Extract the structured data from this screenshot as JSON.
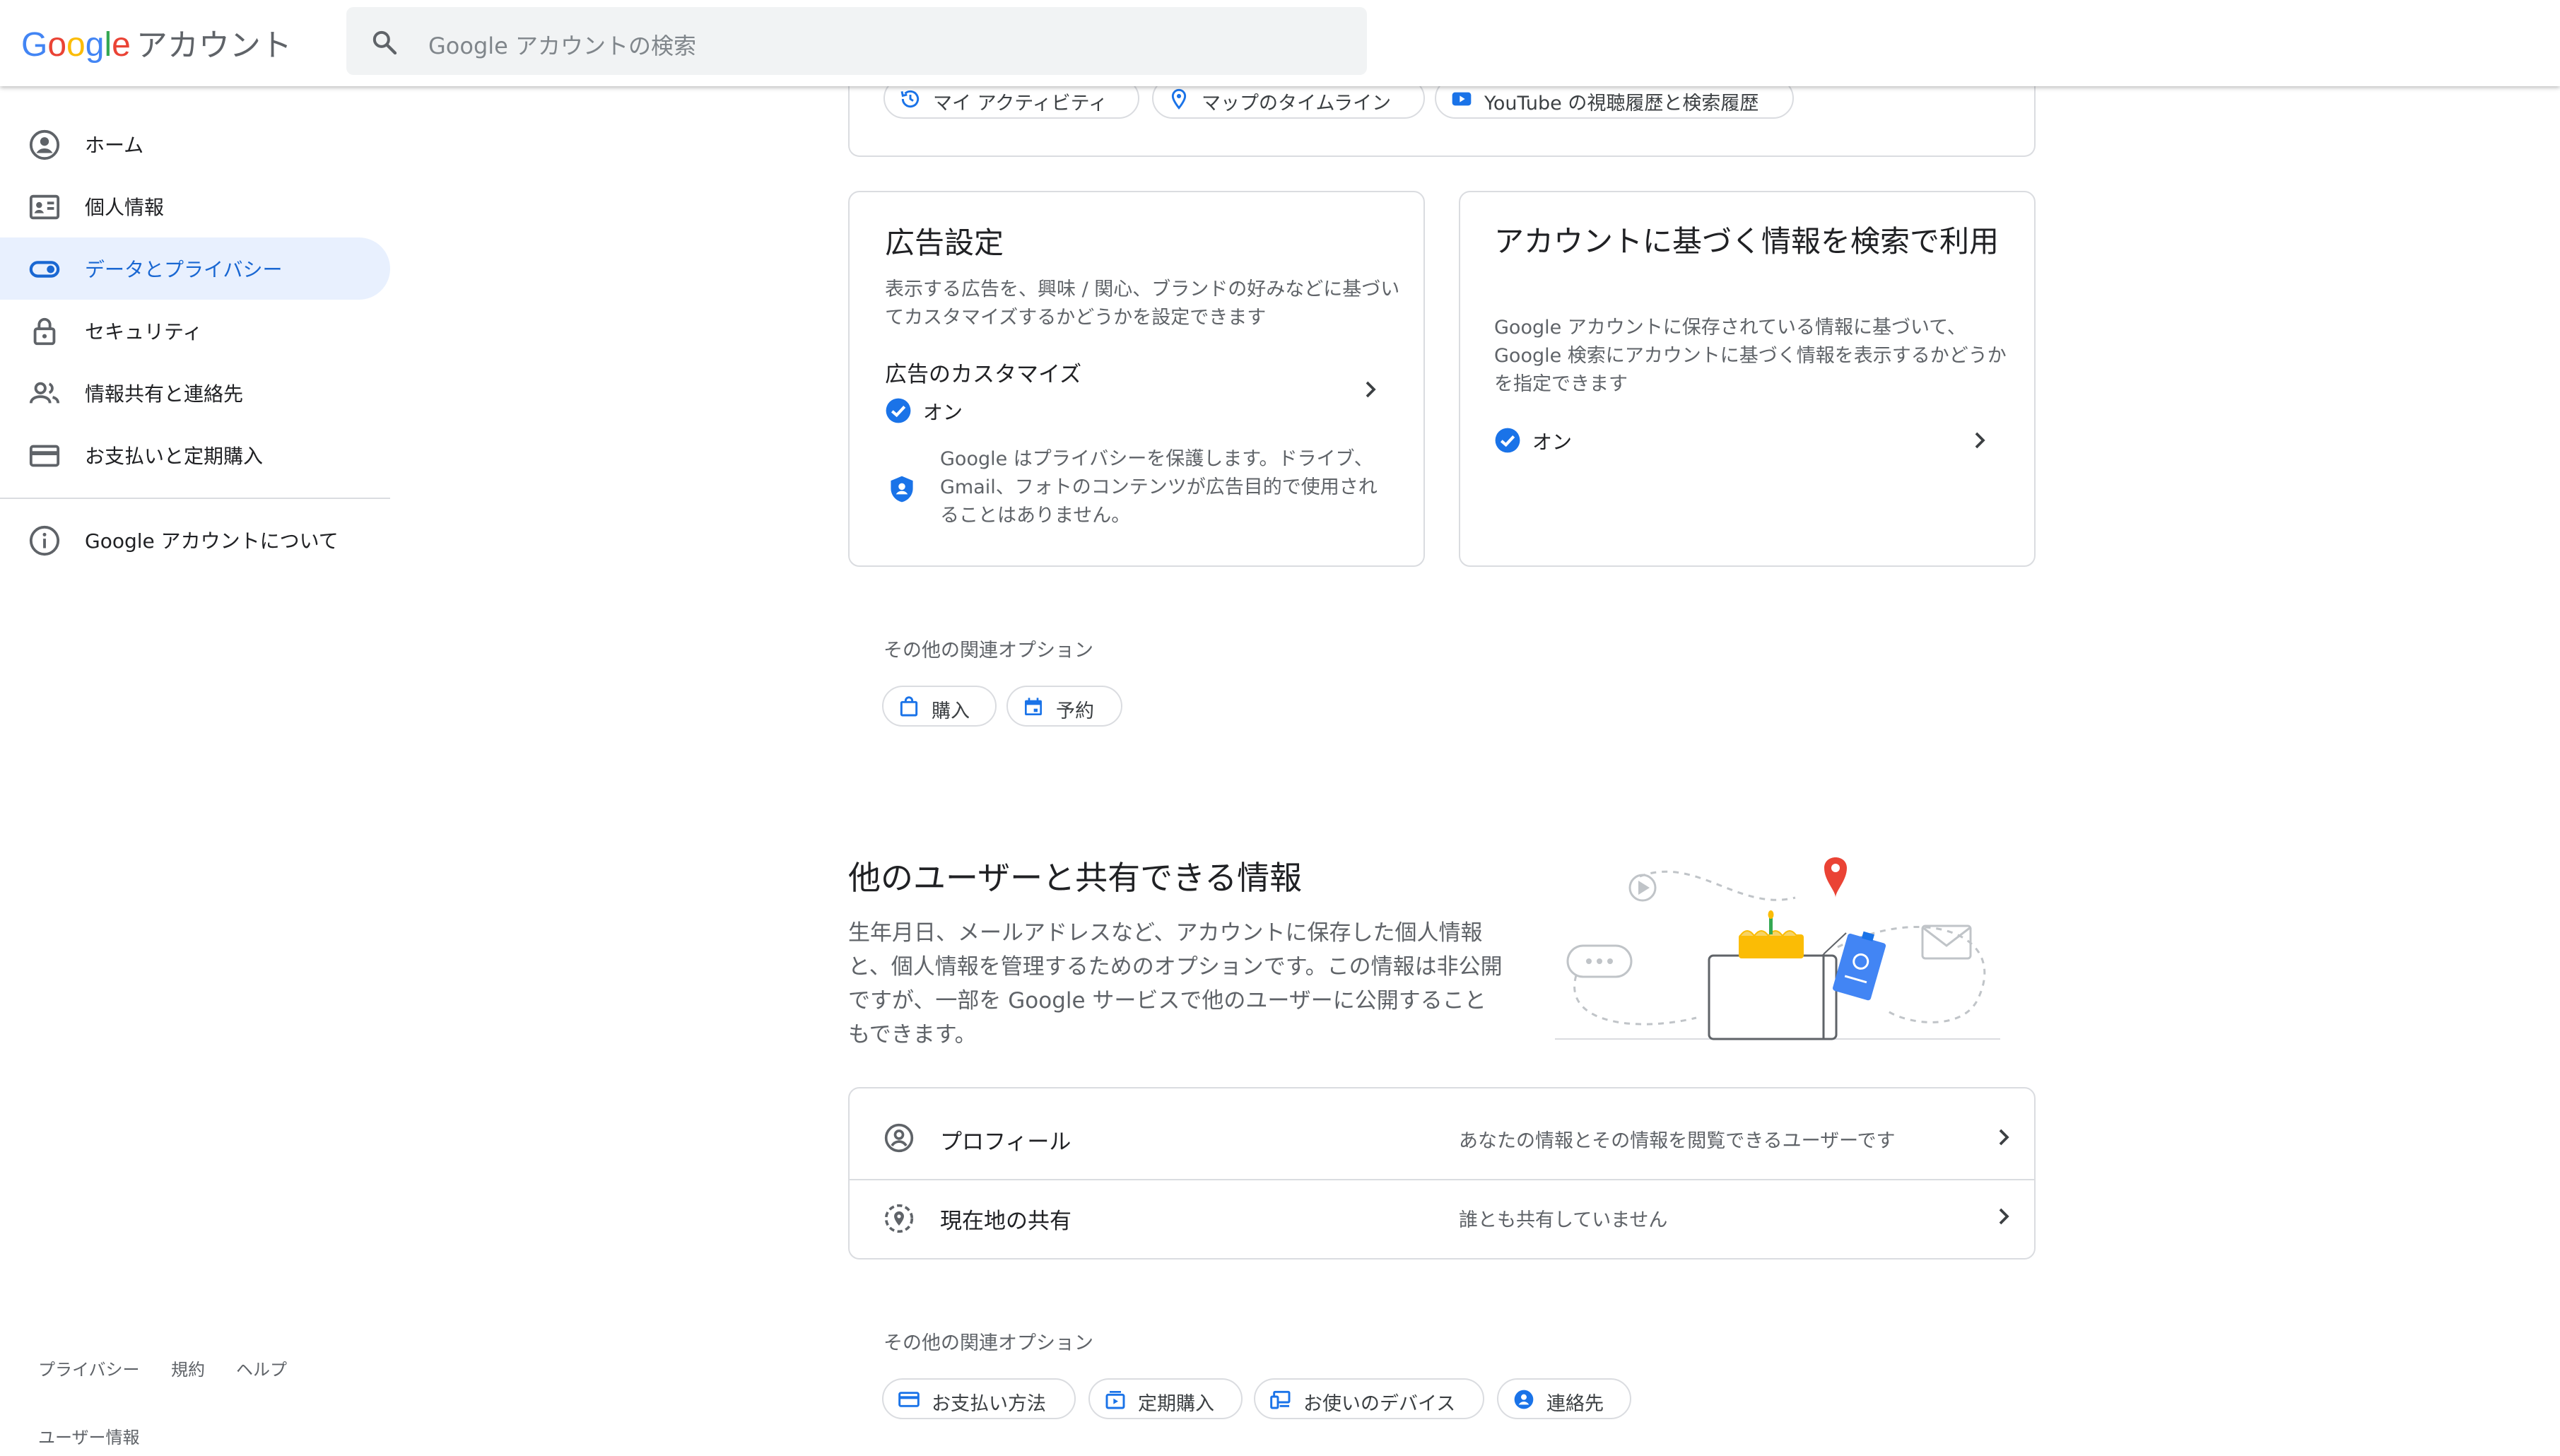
{
  "header": {
    "logo_text": "Google",
    "account_text": "アカウント",
    "search_placeholder": "Google アカウントの検索",
    "logo_colors": [
      "#4285F4",
      "#EA4335",
      "#FBBC05",
      "#4285F4",
      "#34A853",
      "#EA4335"
    ]
  },
  "sidebar": {
    "items": [
      {
        "label": "ホーム",
        "icon": "account-circle-icon"
      },
      {
        "label": "個人情報",
        "icon": "id-card-icon"
      },
      {
        "label": "データとプライバシー",
        "icon": "toggle-icon",
        "active": true
      },
      {
        "label": "セキュリティ",
        "icon": "lock-icon"
      },
      {
        "label": "情報共有と連絡先",
        "icon": "people-icon"
      },
      {
        "label": "お支払いと定期購入",
        "icon": "credit-card-icon"
      }
    ],
    "about": {
      "label": "Google アカウントについて",
      "icon": "info-icon"
    },
    "footer": {
      "privacy": "プライバシー",
      "terms": "規約",
      "help": "ヘルプ",
      "user_info": "ユーザー情報"
    }
  },
  "top_chips": [
    {
      "label": "マイ アクティビティ",
      "icon": "history-icon"
    },
    {
      "label": "マップのタイムライン",
      "icon": "map-pin-icon"
    },
    {
      "label": "YouTube の視聴履歴と検索履歴",
      "icon": "youtube-icon"
    }
  ],
  "ads_card": {
    "title": "広告設定",
    "description": "表示する広告を、興味 / 関心、ブランドの好みなどに基づいてカスタマイズするかどうかを設定できます",
    "setting_title": "広告のカスタマイズ",
    "status": "オン",
    "privacy_note": "Google はプライバシーを保護します。ドライブ、Gmail、フォトのコンテンツが広告目的で使用されることはありません。"
  },
  "search_card": {
    "title": "アカウントに基づく情報を検索で利用",
    "description": "Google アカウントに保存されている情報に基づいて、Google 検索にアカウントに基づく情報を表示するかどうかを指定できます",
    "status": "オン"
  },
  "related_options_1": {
    "label": "その他の関連オプション",
    "chips": [
      {
        "label": "購入",
        "icon": "shopping-bag-icon"
      },
      {
        "label": "予約",
        "icon": "calendar-icon"
      }
    ]
  },
  "share_section": {
    "title": "他のユーザーと共有できる情報",
    "description": "生年月日、メールアドレスなど、アカウントに保存した個人情報と、個人情報を管理するためのオプションです。この情報は非公開ですが、一部を Google サービスで他のユーザーに公開することもできます。",
    "rows": [
      {
        "title": "プロフィール",
        "subtitle": "あなたの情報とその情報を閲覧できるユーザーです",
        "icon": "profile-icon"
      },
      {
        "title": "現在地の共有",
        "subtitle": "誰とも共有していません",
        "icon": "location-sharing-icon"
      }
    ]
  },
  "related_options_2": {
    "label": "その他の関連オプション",
    "chips": [
      {
        "label": "お支払い方法",
        "icon": "credit-card-icon"
      },
      {
        "label": "定期購入",
        "icon": "subscription-icon"
      },
      {
        "label": "お使いのデバイス",
        "icon": "devices-icon"
      },
      {
        "label": "連絡先",
        "icon": "contact-icon"
      }
    ]
  },
  "colors": {
    "accent": "#1a73e8",
    "active_bg": "#e8f0fe",
    "border": "#dadce0",
    "muted": "#5f6368"
  }
}
